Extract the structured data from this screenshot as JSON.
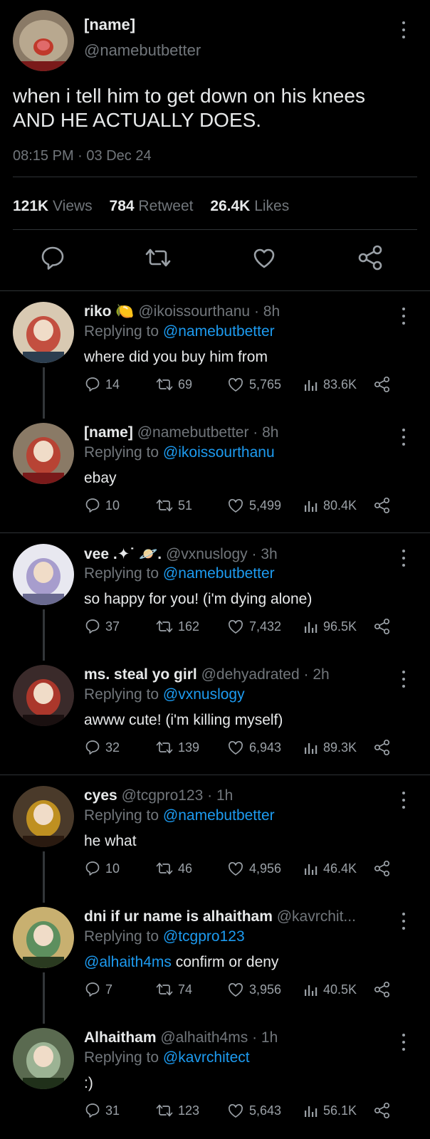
{
  "main_tweet": {
    "name": "[name]",
    "handle": "@namebutbetter",
    "text_line1": "when i tell him to get down on his knees",
    "text_line2": "AND HE ACTUALLY DOES.",
    "time": "08:15 PM",
    "date": "03 Dec 24",
    "views_count": "121K",
    "views_label": "Views",
    "retweet_count": "784",
    "retweet_label": "Retweet",
    "likes_count": "26.4K",
    "likes_label": "Likes"
  },
  "replies": [
    {
      "name": "riko",
      "emoji": "🍋",
      "handle": "@ikoissourthanu",
      "time": "· 8h",
      "replying_label": "Replying to",
      "replying_to": "@namebutbetter",
      "mention": "",
      "text": "where did you buy him from",
      "replies": "14",
      "retweets": "69",
      "likes": "5,765",
      "views": "83.6K"
    },
    {
      "name": "[name]",
      "emoji": "",
      "handle": "@namebutbetter",
      "time": "· 8h",
      "replying_label": "Replying to",
      "replying_to": "@ikoissourthanu",
      "mention": "",
      "text": "ebay",
      "replies": "10",
      "retweets": "51",
      "likes": "5,499",
      "views": "80.4K"
    },
    {
      "name": "vee .✦˙ 🪐.",
      "emoji": "",
      "handle": "@vxnuslogy",
      "time": "· 3h",
      "replying_label": "Replying to",
      "replying_to": "@namebutbetter",
      "mention": "",
      "text": "so happy for you! (i'm dying alone)",
      "replies": "37",
      "retweets": "162",
      "likes": "7,432",
      "views": "96.5K"
    },
    {
      "name": "ms. steal yo girl",
      "emoji": "",
      "handle": "@dehyadrated",
      "time": "· 2h",
      "replying_label": "Replying to",
      "replying_to": "@vxnuslogy",
      "mention": "",
      "text": "awww cute! (i'm killing myself)",
      "replies": "32",
      "retweets": "139",
      "likes": "6,943",
      "views": "89.3K"
    },
    {
      "name": "cyes",
      "emoji": "",
      "handle": "@tcgpro123",
      "time": "· 1h",
      "replying_label": "Replying to",
      "replying_to": "@namebutbetter",
      "mention": "",
      "text": "he what",
      "replies": "10",
      "retweets": "46",
      "likes": "4,956",
      "views": "46.4K"
    },
    {
      "name": "dni if ur name is alhaitham",
      "emoji": "",
      "handle": "@kavrchit...",
      "time": "",
      "replying_label": "Replying to",
      "replying_to": "@tcgpro123",
      "mention": "@alhaith4ms",
      "text": " confirm or deny",
      "replies": "7",
      "retweets": "74",
      "likes": "3,956",
      "views": "40.5K"
    },
    {
      "name": "Alhaitham",
      "emoji": "",
      "handle": "@alhaith4ms",
      "time": "· 1h",
      "replying_label": "Replying to",
      "replying_to": "@kavrchitect",
      "mention": "",
      "text": ":)",
      "replies": "31",
      "retweets": "123",
      "likes": "5,643",
      "views": "56.1K"
    }
  ],
  "colors": {
    "background": "#000000",
    "text": "#e7e9ea",
    "muted": "#71767b",
    "link": "#1d9bf0",
    "divider": "#2f3336"
  }
}
